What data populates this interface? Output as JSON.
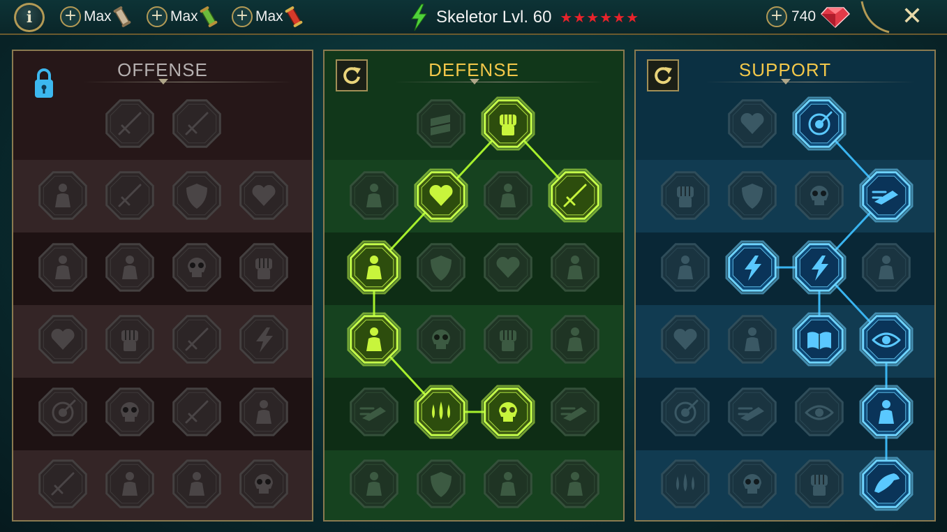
{
  "topbar": {
    "info_label": "i",
    "resources": [
      {
        "label": "Max",
        "icon": "scroll-tan-icon",
        "color": "#c9b79a"
      },
      {
        "label": "Max",
        "icon": "scroll-green-icon",
        "color": "#6cbb3c"
      },
      {
        "label": "Max",
        "icon": "scroll-red-icon",
        "color": "#d63a2a"
      }
    ],
    "champion": "Skeletor Lvl. 60",
    "stars": "★★★★★★",
    "gems": "740",
    "close_label": "✕"
  },
  "colors": {
    "offense_bg": "#2a1a1b",
    "defense_bg": "#123a1c",
    "support_bg": "#0c3346",
    "defense_active": "#a6f02c",
    "support_active": "#39b4f0",
    "star": "#e8232b",
    "gold": "#f3c84a"
  },
  "trees": [
    {
      "key": "offense",
      "title": "OFFENSE",
      "locked": true,
      "nodes": [
        {
          "row": 0,
          "col": 1,
          "icon": "crossed-swords-icon",
          "active": false
        },
        {
          "row": 0,
          "col": 2,
          "icon": "claw-slash-icon",
          "active": false
        },
        {
          "row": 1,
          "col": 0,
          "icon": "horned-demon-icon",
          "active": false
        },
        {
          "row": 1,
          "col": 1,
          "icon": "cape-blade-icon",
          "active": false
        },
        {
          "row": 1,
          "col": 2,
          "icon": "shield-break-icon",
          "active": false
        },
        {
          "row": 1,
          "col": 3,
          "icon": "broken-heart-icon",
          "active": false
        },
        {
          "row": 2,
          "col": 0,
          "icon": "charging-warrior-icon",
          "active": false
        },
        {
          "row": 2,
          "col": 1,
          "icon": "fanged-maw-icon",
          "active": false
        },
        {
          "row": 2,
          "col": 2,
          "icon": "skull-wind-icon",
          "active": false
        },
        {
          "row": 2,
          "col": 3,
          "icon": "dagger-hand-icon",
          "active": false
        },
        {
          "row": 3,
          "col": 0,
          "icon": "bleeding-heart-icon",
          "active": false
        },
        {
          "row": 3,
          "col": 1,
          "icon": "fist-strike-icon",
          "active": false
        },
        {
          "row": 3,
          "col": 2,
          "icon": "axe-icon",
          "active": false
        },
        {
          "row": 3,
          "col": 3,
          "icon": "chain-lightning-icon",
          "active": false
        },
        {
          "row": 4,
          "col": 0,
          "icon": "arrow-burst-icon",
          "active": false
        },
        {
          "row": 4,
          "col": 1,
          "icon": "skull-icon",
          "active": false
        },
        {
          "row": 4,
          "col": 2,
          "icon": "sword-circle-icon",
          "active": false
        },
        {
          "row": 4,
          "col": 3,
          "icon": "shocked-figure-icon",
          "active": false
        },
        {
          "row": 5,
          "col": 0,
          "icon": "sparkle-blade-icon",
          "active": false
        },
        {
          "row": 5,
          "col": 1,
          "icon": "knight-helm-icon",
          "active": false
        },
        {
          "row": 5,
          "col": 2,
          "icon": "horned-beast-icon",
          "active": false
        },
        {
          "row": 5,
          "col": 3,
          "icon": "spiked-skull-icon",
          "active": false
        }
      ],
      "links": []
    },
    {
      "key": "defense",
      "title": "DEFENSE",
      "locked": false,
      "nodes": [
        {
          "row": 0,
          "col": 1,
          "icon": "wall-bricks-icon",
          "active": false
        },
        {
          "row": 0,
          "col": 2,
          "icon": "raised-fist-icon",
          "active": true
        },
        {
          "row": 1,
          "col": 0,
          "icon": "hooded-figure-icon",
          "active": false
        },
        {
          "row": 1,
          "col": 1,
          "icon": "anatomical-heart-icon",
          "active": true
        },
        {
          "row": 1,
          "col": 2,
          "icon": "muscular-torso-icon",
          "active": false
        },
        {
          "row": 1,
          "col": 3,
          "icon": "crossed-blades-icon",
          "active": true
        },
        {
          "row": 2,
          "col": 0,
          "icon": "dueling-figures-icon",
          "active": true
        },
        {
          "row": 2,
          "col": 1,
          "icon": "guard-shield-icon",
          "active": false
        },
        {
          "row": 2,
          "col": 2,
          "icon": "heart-shield-icon",
          "active": false
        },
        {
          "row": 2,
          "col": 3,
          "icon": "aura-figure-icon",
          "active": false
        },
        {
          "row": 3,
          "col": 0,
          "icon": "rallying-crowd-icon",
          "active": true
        },
        {
          "row": 3,
          "col": 1,
          "icon": "hourglass-skull-icon",
          "active": false
        },
        {
          "row": 3,
          "col": 2,
          "icon": "open-hand-icon",
          "active": false
        },
        {
          "row": 3,
          "col": 3,
          "icon": "bull-head-icon",
          "active": false
        },
        {
          "row": 4,
          "col": 0,
          "icon": "running-figure-icon",
          "active": false
        },
        {
          "row": 4,
          "col": 1,
          "icon": "poison-drops-icon",
          "active": true
        },
        {
          "row": 4,
          "col": 2,
          "icon": "burning-skull-icon",
          "active": true
        },
        {
          "row": 4,
          "col": 3,
          "icon": "dodge-arrow-icon",
          "active": false
        },
        {
          "row": 5,
          "col": 0,
          "icon": "crowned-figure-icon",
          "active": false
        },
        {
          "row": 5,
          "col": 1,
          "icon": "winged-shield-icon",
          "active": false
        },
        {
          "row": 5,
          "col": 2,
          "icon": "bearded-face-icon",
          "active": false
        },
        {
          "row": 5,
          "col": 3,
          "icon": "flexing-figure-icon",
          "active": false
        }
      ],
      "links": [
        [
          [
            0,
            2
          ],
          [
            1,
            1
          ]
        ],
        [
          [
            0,
            2
          ],
          [
            1,
            3
          ]
        ],
        [
          [
            1,
            1
          ],
          [
            2,
            0
          ]
        ],
        [
          [
            2,
            0
          ],
          [
            3,
            0
          ]
        ],
        [
          [
            3,
            0
          ],
          [
            4,
            1
          ]
        ],
        [
          [
            4,
            1
          ],
          [
            4,
            2
          ]
        ]
      ]
    },
    {
      "key": "support",
      "title": "SUPPORT",
      "locked": false,
      "nodes": [
        {
          "row": 0,
          "col": 1,
          "icon": "heart-plus-icon",
          "active": false
        },
        {
          "row": 0,
          "col": 2,
          "icon": "target-strike-icon",
          "active": true
        },
        {
          "row": 1,
          "col": 0,
          "icon": "praying-hands-icon",
          "active": false
        },
        {
          "row": 1,
          "col": 1,
          "icon": "rainbow-shield-icon",
          "active": false
        },
        {
          "row": 1,
          "col": 2,
          "icon": "smoking-skull-icon",
          "active": false
        },
        {
          "row": 1,
          "col": 3,
          "icon": "speed-dash-icon",
          "active": true
        },
        {
          "row": 2,
          "col": 0,
          "icon": "healing-figure-icon",
          "active": false
        },
        {
          "row": 2,
          "col": 1,
          "icon": "lightning-bolt-icon",
          "active": true
        },
        {
          "row": 2,
          "col": 2,
          "icon": "shatter-icon",
          "active": true
        },
        {
          "row": 2,
          "col": 3,
          "icon": "double-figure-icon",
          "active": false
        },
        {
          "row": 3,
          "col": 0,
          "icon": "chained-heart-icon",
          "active": false
        },
        {
          "row": 3,
          "col": 1,
          "icon": "comet-icon",
          "active": false
        },
        {
          "row": 3,
          "col": 2,
          "icon": "open-book-icon",
          "active": true
        },
        {
          "row": 3,
          "col": 3,
          "icon": "fierce-eyes-icon",
          "active": true
        },
        {
          "row": 4,
          "col": 0,
          "icon": "compass-star-icon",
          "active": false
        },
        {
          "row": 4,
          "col": 1,
          "icon": "stomp-boot-icon",
          "active": false
        },
        {
          "row": 4,
          "col": 2,
          "icon": "all-seeing-eye-icon",
          "active": false
        },
        {
          "row": 4,
          "col": 3,
          "icon": "voodoo-doll-icon",
          "active": true
        },
        {
          "row": 5,
          "col": 0,
          "icon": "potion-flask-icon",
          "active": false
        },
        {
          "row": 5,
          "col": 1,
          "icon": "skull-crest-icon",
          "active": false
        },
        {
          "row": 5,
          "col": 2,
          "icon": "gripping-fist-icon",
          "active": false
        },
        {
          "row": 5,
          "col": 3,
          "icon": "eagle-head-icon",
          "active": true
        }
      ],
      "links": [
        [
          [
            0,
            2
          ],
          [
            1,
            3
          ]
        ],
        [
          [
            1,
            3
          ],
          [
            2,
            2
          ]
        ],
        [
          [
            2,
            1
          ],
          [
            2,
            2
          ]
        ],
        [
          [
            2,
            2
          ],
          [
            3,
            2
          ]
        ],
        [
          [
            2,
            2
          ],
          [
            3,
            3
          ]
        ],
        [
          [
            3,
            3
          ],
          [
            4,
            3
          ]
        ],
        [
          [
            4,
            3
          ],
          [
            5,
            3
          ]
        ]
      ]
    }
  ]
}
